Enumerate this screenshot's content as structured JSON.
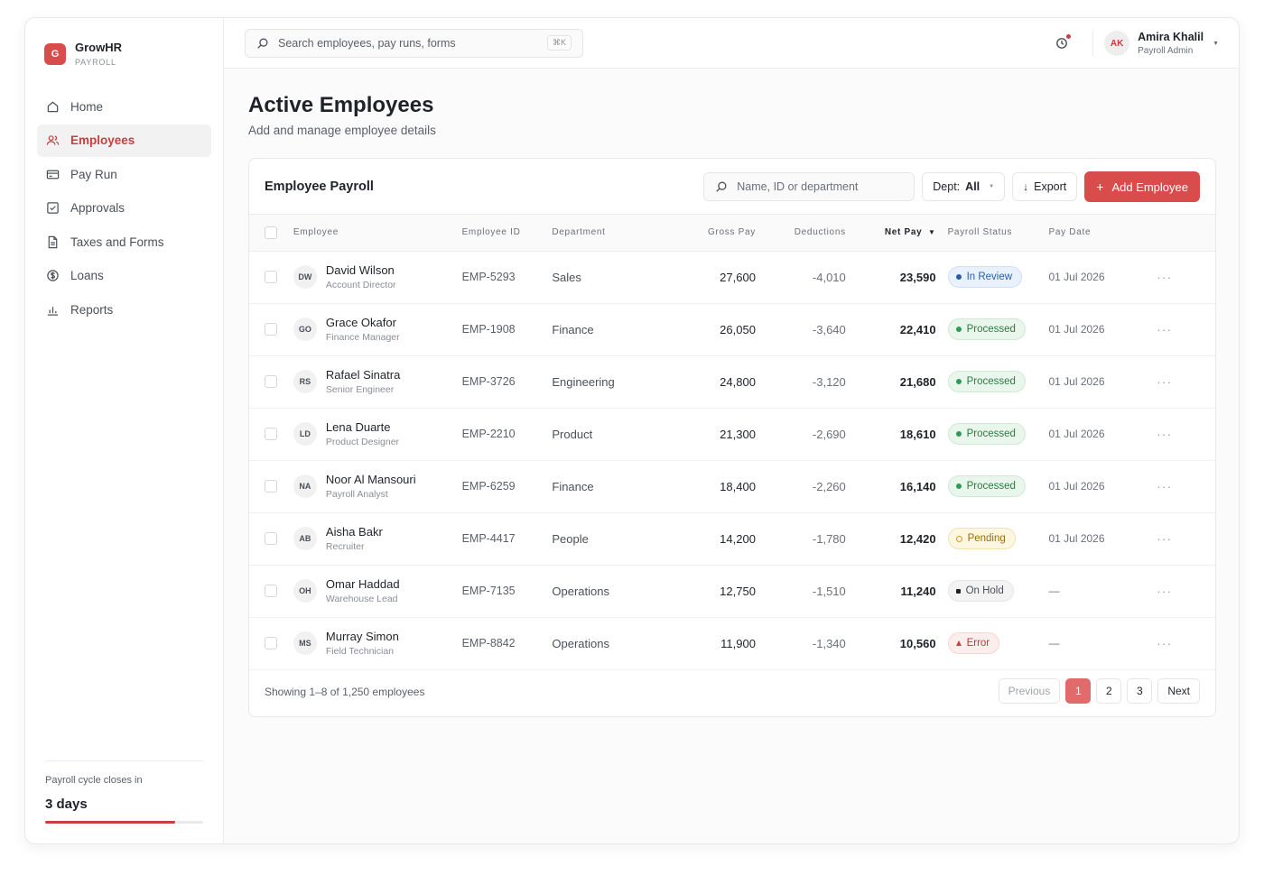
{
  "brand": {
    "logo_letter": "G",
    "name": "GrowHR",
    "subtitle": "PAYROLL"
  },
  "sidebar": {
    "items": [
      {
        "label": "Home",
        "icon": "home-icon",
        "active": false
      },
      {
        "label": "Employees",
        "icon": "users-icon",
        "active": true
      },
      {
        "label": "Pay Run",
        "icon": "card-icon",
        "active": false
      },
      {
        "label": "Approvals",
        "icon": "check-square-icon",
        "active": false
      },
      {
        "label": "Taxes and Forms",
        "icon": "document-icon",
        "active": false
      },
      {
        "label": "Loans",
        "icon": "dollar-circle-icon",
        "active": false
      },
      {
        "label": "Reports",
        "icon": "bar-chart-icon",
        "active": false
      }
    ],
    "footer": {
      "label": "Payroll cycle closes in",
      "value": "3 days",
      "progress": 0.82
    }
  },
  "topbar": {
    "search_placeholder": "Search employees, pay runs, forms",
    "shortcut": "⌘K",
    "user": {
      "initials": "AK",
      "name": "Amira Khalil",
      "role": "Payroll Admin"
    }
  },
  "page": {
    "title": "Active Employees",
    "subtitle": "Add and manage employee details"
  },
  "card": {
    "title": "Employee Payroll",
    "search_placeholder": "Name, ID or department",
    "dept_label": "Dept:",
    "dept_value": "All",
    "export_label": "Export",
    "add_label": "Add Employee"
  },
  "table": {
    "headers": {
      "employee": "Employee",
      "id": "Employee ID",
      "department": "Department",
      "gross": "Gross Pay",
      "deductions": "Deductions",
      "net": "Net Pay",
      "status": "Payroll Status",
      "date": "Pay Date"
    },
    "rows": [
      {
        "initials": "DW",
        "name": "David Wilson",
        "role": "Account Director",
        "id": "EMP-5293",
        "department": "Sales",
        "gross": "27,600",
        "deductions": "-4,010",
        "net": "23,590",
        "status": "In Review",
        "status_kind": "review",
        "date": "01 Jul 2026"
      },
      {
        "initials": "GO",
        "name": "Grace Okafor",
        "role": "Finance Manager",
        "id": "EMP-1908",
        "department": "Finance",
        "gross": "26,050",
        "deductions": "-3,640",
        "net": "22,410",
        "status": "Processed",
        "status_kind": "processed",
        "date": "01 Jul 2026"
      },
      {
        "initials": "RS",
        "name": "Rafael Sinatra",
        "role": "Senior Engineer",
        "id": "EMP-3726",
        "department": "Engineering",
        "gross": "24,800",
        "deductions": "-3,120",
        "net": "21,680",
        "status": "Processed",
        "status_kind": "processed",
        "date": "01 Jul 2026"
      },
      {
        "initials": "LD",
        "name": "Lena Duarte",
        "role": "Product Designer",
        "id": "EMP-2210",
        "department": "Product",
        "gross": "21,300",
        "deductions": "-2,690",
        "net": "18,610",
        "status": "Processed",
        "status_kind": "processed",
        "date": "01 Jul 2026"
      },
      {
        "initials": "NA",
        "name": "Noor Al Mansouri",
        "role": "Payroll Analyst",
        "id": "EMP-6259",
        "department": "Finance",
        "gross": "18,400",
        "deductions": "-2,260",
        "net": "16,140",
        "status": "Processed",
        "status_kind": "processed",
        "date": "01 Jul 2026"
      },
      {
        "initials": "AB",
        "name": "Aisha Bakr",
        "role": "Recruiter",
        "id": "EMP-4417",
        "department": "People",
        "gross": "14,200",
        "deductions": "-1,780",
        "net": "12,420",
        "status": "Pending",
        "status_kind": "pending",
        "date": "01 Jul 2026"
      },
      {
        "initials": "OH",
        "name": "Omar Haddad",
        "role": "Warehouse Lead",
        "id": "EMP-7135",
        "department": "Operations",
        "gross": "12,750",
        "deductions": "-1,510",
        "net": "11,240",
        "status": "On Hold",
        "status_kind": "hold",
        "date": "—"
      },
      {
        "initials": "MS",
        "name": "Murray Simon",
        "role": "Field Technician",
        "id": "EMP-8842",
        "department": "Operations",
        "gross": "11,900",
        "deductions": "-1,340",
        "net": "10,560",
        "status": "Error",
        "status_kind": "error",
        "date": "—"
      }
    ]
  },
  "footer": {
    "showing": "Showing 1–8 of 1,250 employees",
    "previous": "Previous",
    "pages": [
      "1",
      "2",
      "3"
    ],
    "current_page": "1",
    "next": "Next"
  },
  "colors": {
    "accent": "#d94c4c",
    "accent_dark": "#c93f3f"
  }
}
